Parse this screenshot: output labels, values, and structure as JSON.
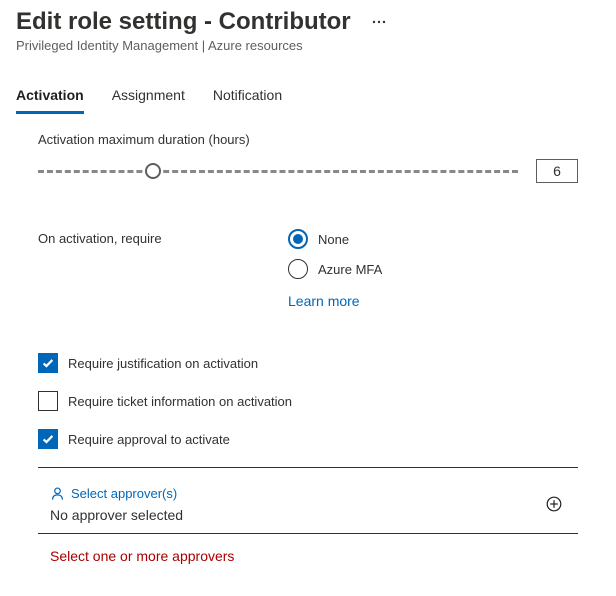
{
  "header": {
    "title": "Edit role setting - Contributor",
    "subtitle": "Privileged Identity Management | Azure resources"
  },
  "tabs": {
    "activation": "Activation",
    "assignment": "Assignment",
    "notification": "Notification"
  },
  "activation": {
    "duration_label": "Activation maximum duration (hours)",
    "duration_value": "6",
    "thumb_percent": 24,
    "require_label": "On activation, require",
    "radio_none": "None",
    "radio_mfa": "Azure MFA",
    "learn_more": "Learn more",
    "check_justification": "Require justification on activation",
    "check_ticket": "Require ticket information on activation",
    "check_approval": "Require approval to activate",
    "approvers_title": "Select approver(s)",
    "approvers_value": "No approver selected",
    "error": "Select one or more approvers"
  }
}
